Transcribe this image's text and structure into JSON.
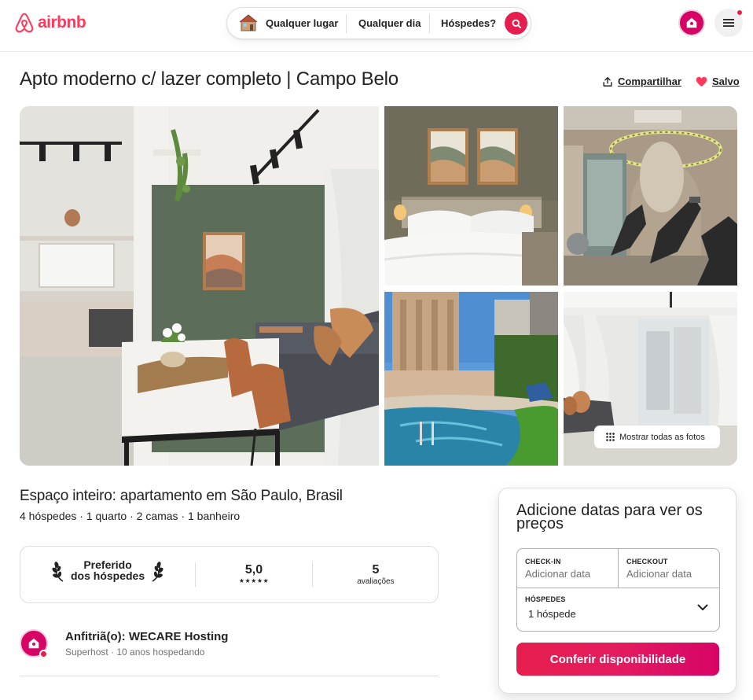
{
  "header": {
    "logo_text": "airbnb",
    "search": {
      "where": "Qualquer lugar",
      "when": "Qualquer dia",
      "who": "Hóspedes?"
    },
    "brand_color": "#ff385c",
    "icons": [
      "airbnb-logo-icon",
      "house-icon",
      "search-icon",
      "host-avatar-icon",
      "menu-icon",
      "notification-dot"
    ]
  },
  "listing": {
    "title": "Apto moderno c/ lazer completo | Campo Belo",
    "share_label": "Compartilhar",
    "save_label": "Salvo",
    "show_all_photos_label": "Mostrar todas as fotos",
    "space_title": "Espaço inteiro: apartamento em São Paulo, Brasil",
    "space_details": "4 hóspedes · 1 quarto · 2 camas · 1 banheiro"
  },
  "highlights": {
    "guest_favorite_line1": "Preferido",
    "guest_favorite_line2": "dos hóspedes",
    "rating": "5,0",
    "stars": "★★★★★",
    "review_count": "5",
    "review_label": "avaliações"
  },
  "host": {
    "name": "Anfitriã(o): WECARE Hosting",
    "subtitle": "Superhost · 10 anos hospedando"
  },
  "booking": {
    "title": "Adicione datas para ver os preços",
    "checkin_label": "CHECK-IN",
    "checkin_placeholder": "Adicionar data",
    "checkout_label": "CHECKOUT",
    "checkout_placeholder": "Adicionar data",
    "guests_label": "HÓSPEDES",
    "guests_value": "1 hóspede",
    "cta_label": "Conferir disponibilidade",
    "cta_color": "#e61e4d"
  }
}
